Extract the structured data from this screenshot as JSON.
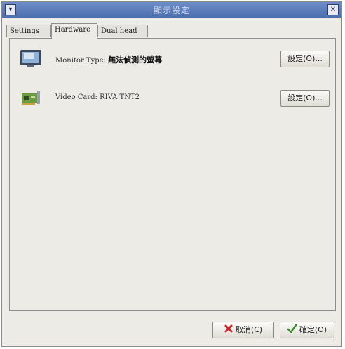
{
  "window": {
    "title": "顯示設定",
    "menu_glyph": "▾",
    "close_glyph": "✕"
  },
  "tabs": [
    {
      "label": "Settings",
      "active": false
    },
    {
      "label": "Hardware",
      "active": true
    },
    {
      "label": "Dual head",
      "active": false
    }
  ],
  "hardware": {
    "monitor": {
      "prefix": "Monitor Type:",
      "value": "無法偵測的螢幕",
      "button": "設定(O)..."
    },
    "video": {
      "prefix": "Video Card:",
      "value": "RIVA TNT2",
      "button": "設定(O)..."
    }
  },
  "footer": {
    "cancel": "取消(C)",
    "ok": "確定(O)"
  },
  "colors": {
    "titlebar": "#5a7bb8",
    "background": "#ecebe6",
    "cancel_icon": "#c8232c",
    "ok_icon": "#3a8f2a"
  }
}
